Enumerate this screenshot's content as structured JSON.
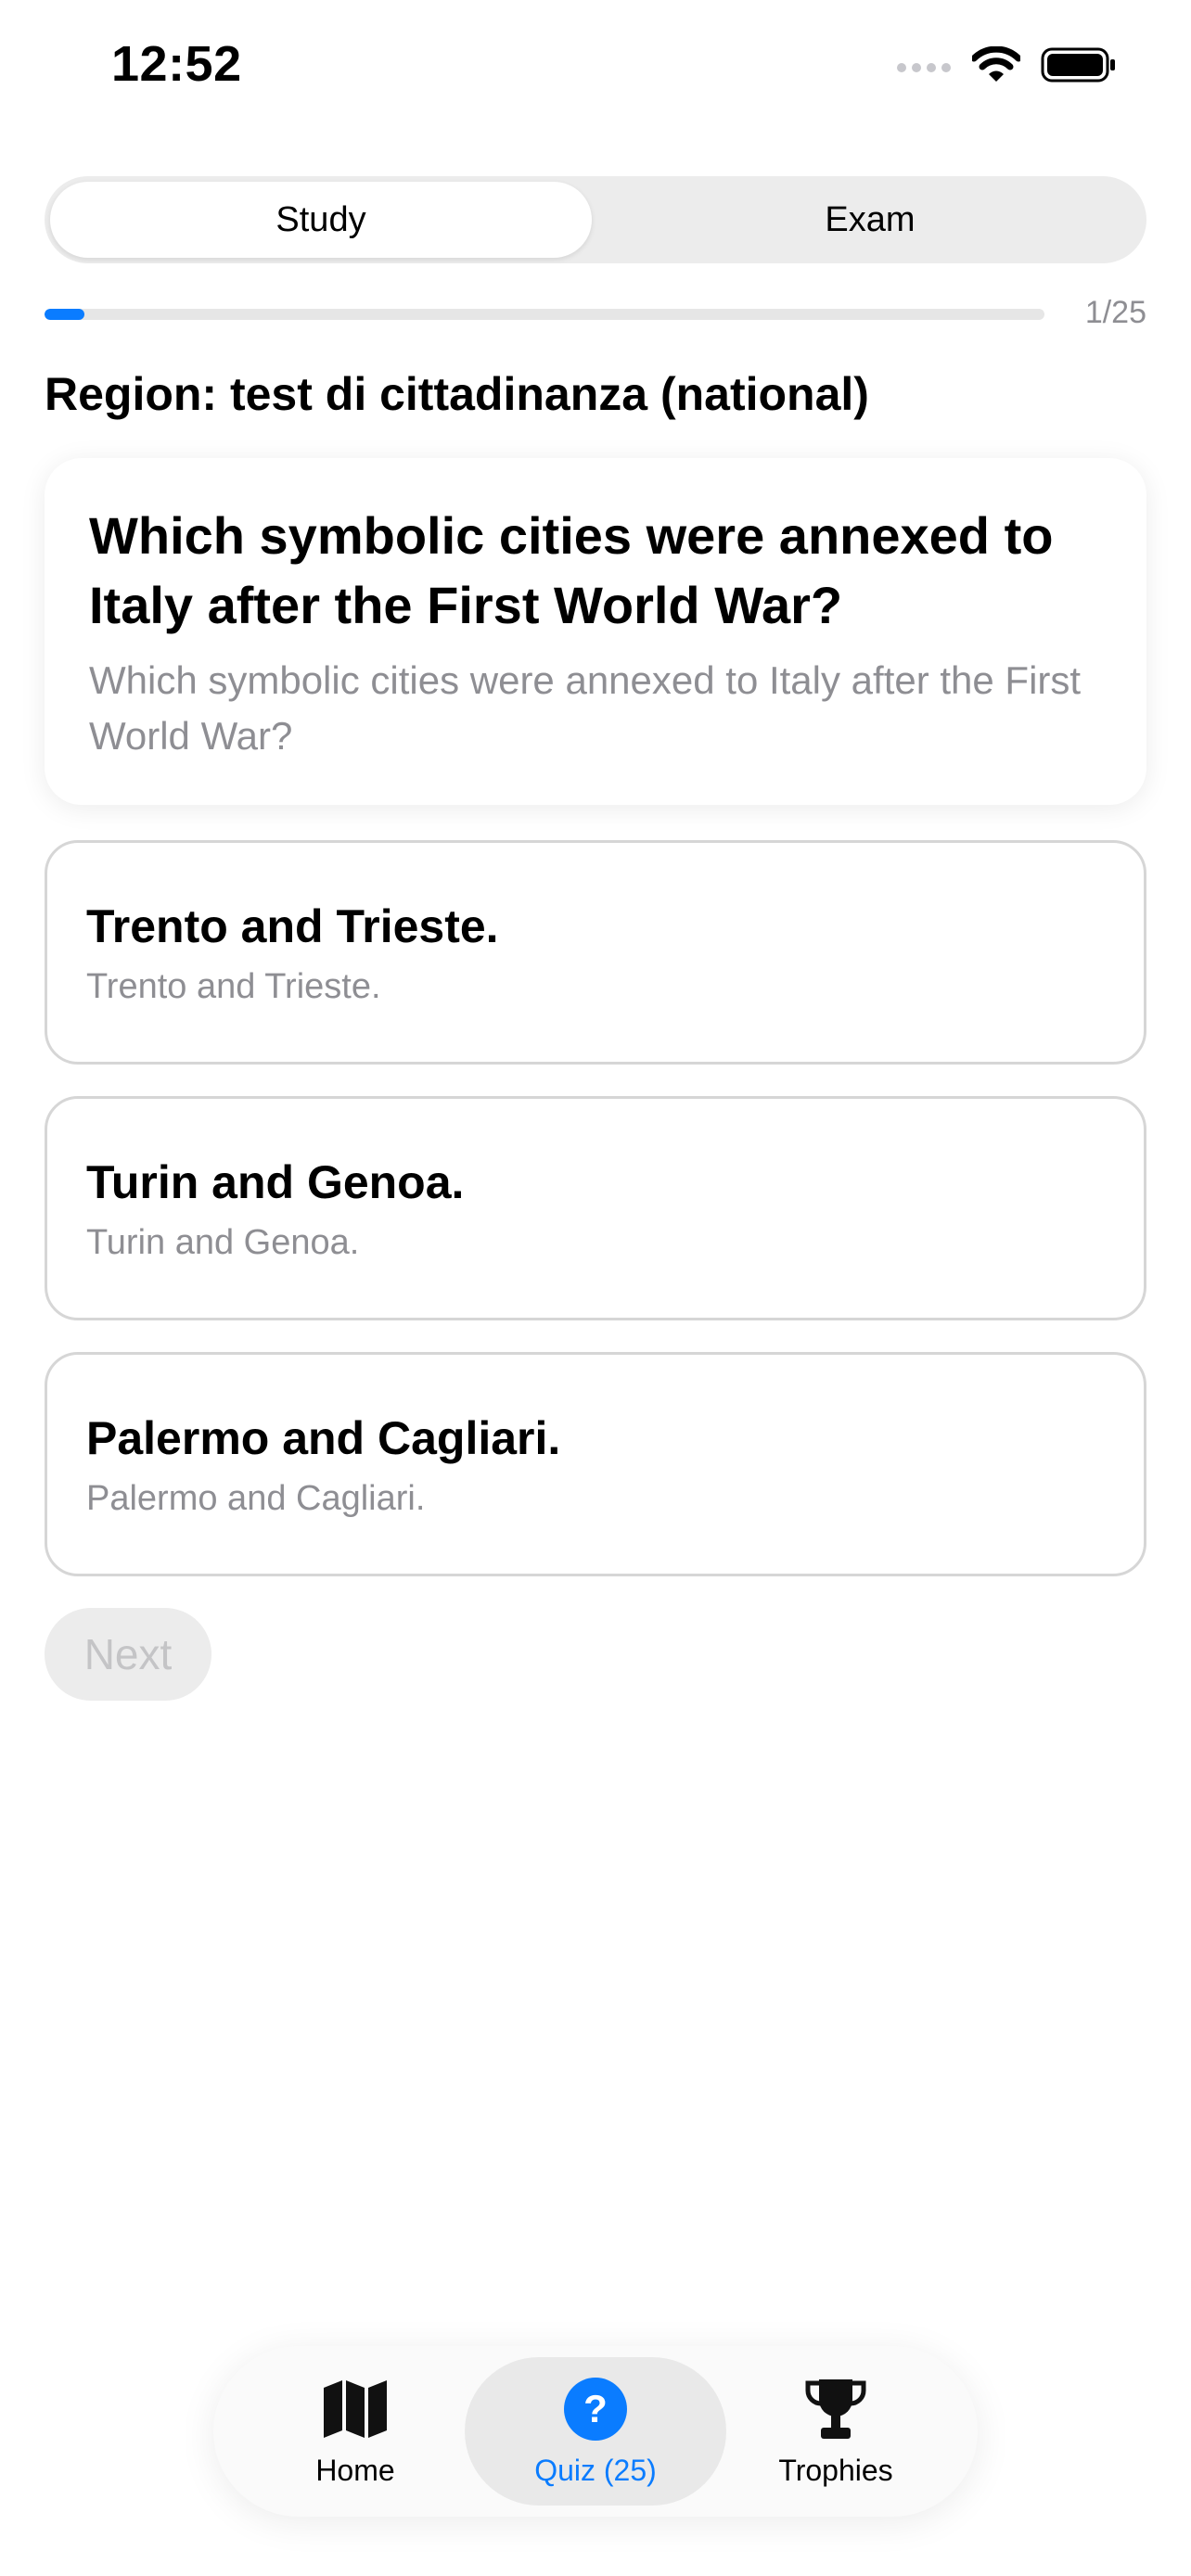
{
  "status_bar": {
    "time": "12:52"
  },
  "segmented_control": {
    "options": [
      "Study",
      "Exam"
    ],
    "selected": "Study"
  },
  "progress": {
    "current": 1,
    "total": 25,
    "label": "1/25",
    "fraction": 0.04
  },
  "region_label": "Region: test di cittadinanza (national)",
  "question": {
    "title": "Which symbolic cities were annexed to Italy after the First World War?",
    "subtitle": "Which symbolic cities were annexed to Italy after the First World War?"
  },
  "answers": [
    {
      "title": "Trento and Trieste.",
      "subtitle": "Trento and Trieste."
    },
    {
      "title": "Turin and Genoa.",
      "subtitle": "Turin and Genoa."
    },
    {
      "title": "Palermo and Cagliari.",
      "subtitle": "Palermo and Cagliari."
    }
  ],
  "next_button": {
    "label": "Next",
    "enabled": false
  },
  "tab_bar": {
    "tabs": [
      {
        "label": "Home",
        "icon": "map-icon"
      },
      {
        "label": "Quiz (25)",
        "icon": "question-circle-icon"
      },
      {
        "label": "Trophies",
        "icon": "trophy-icon"
      }
    ],
    "selected": "Quiz (25)"
  },
  "colors": {
    "accent": "#0a7cff",
    "secondary_text": "#8e8e93",
    "border": "#d6d6d6"
  }
}
